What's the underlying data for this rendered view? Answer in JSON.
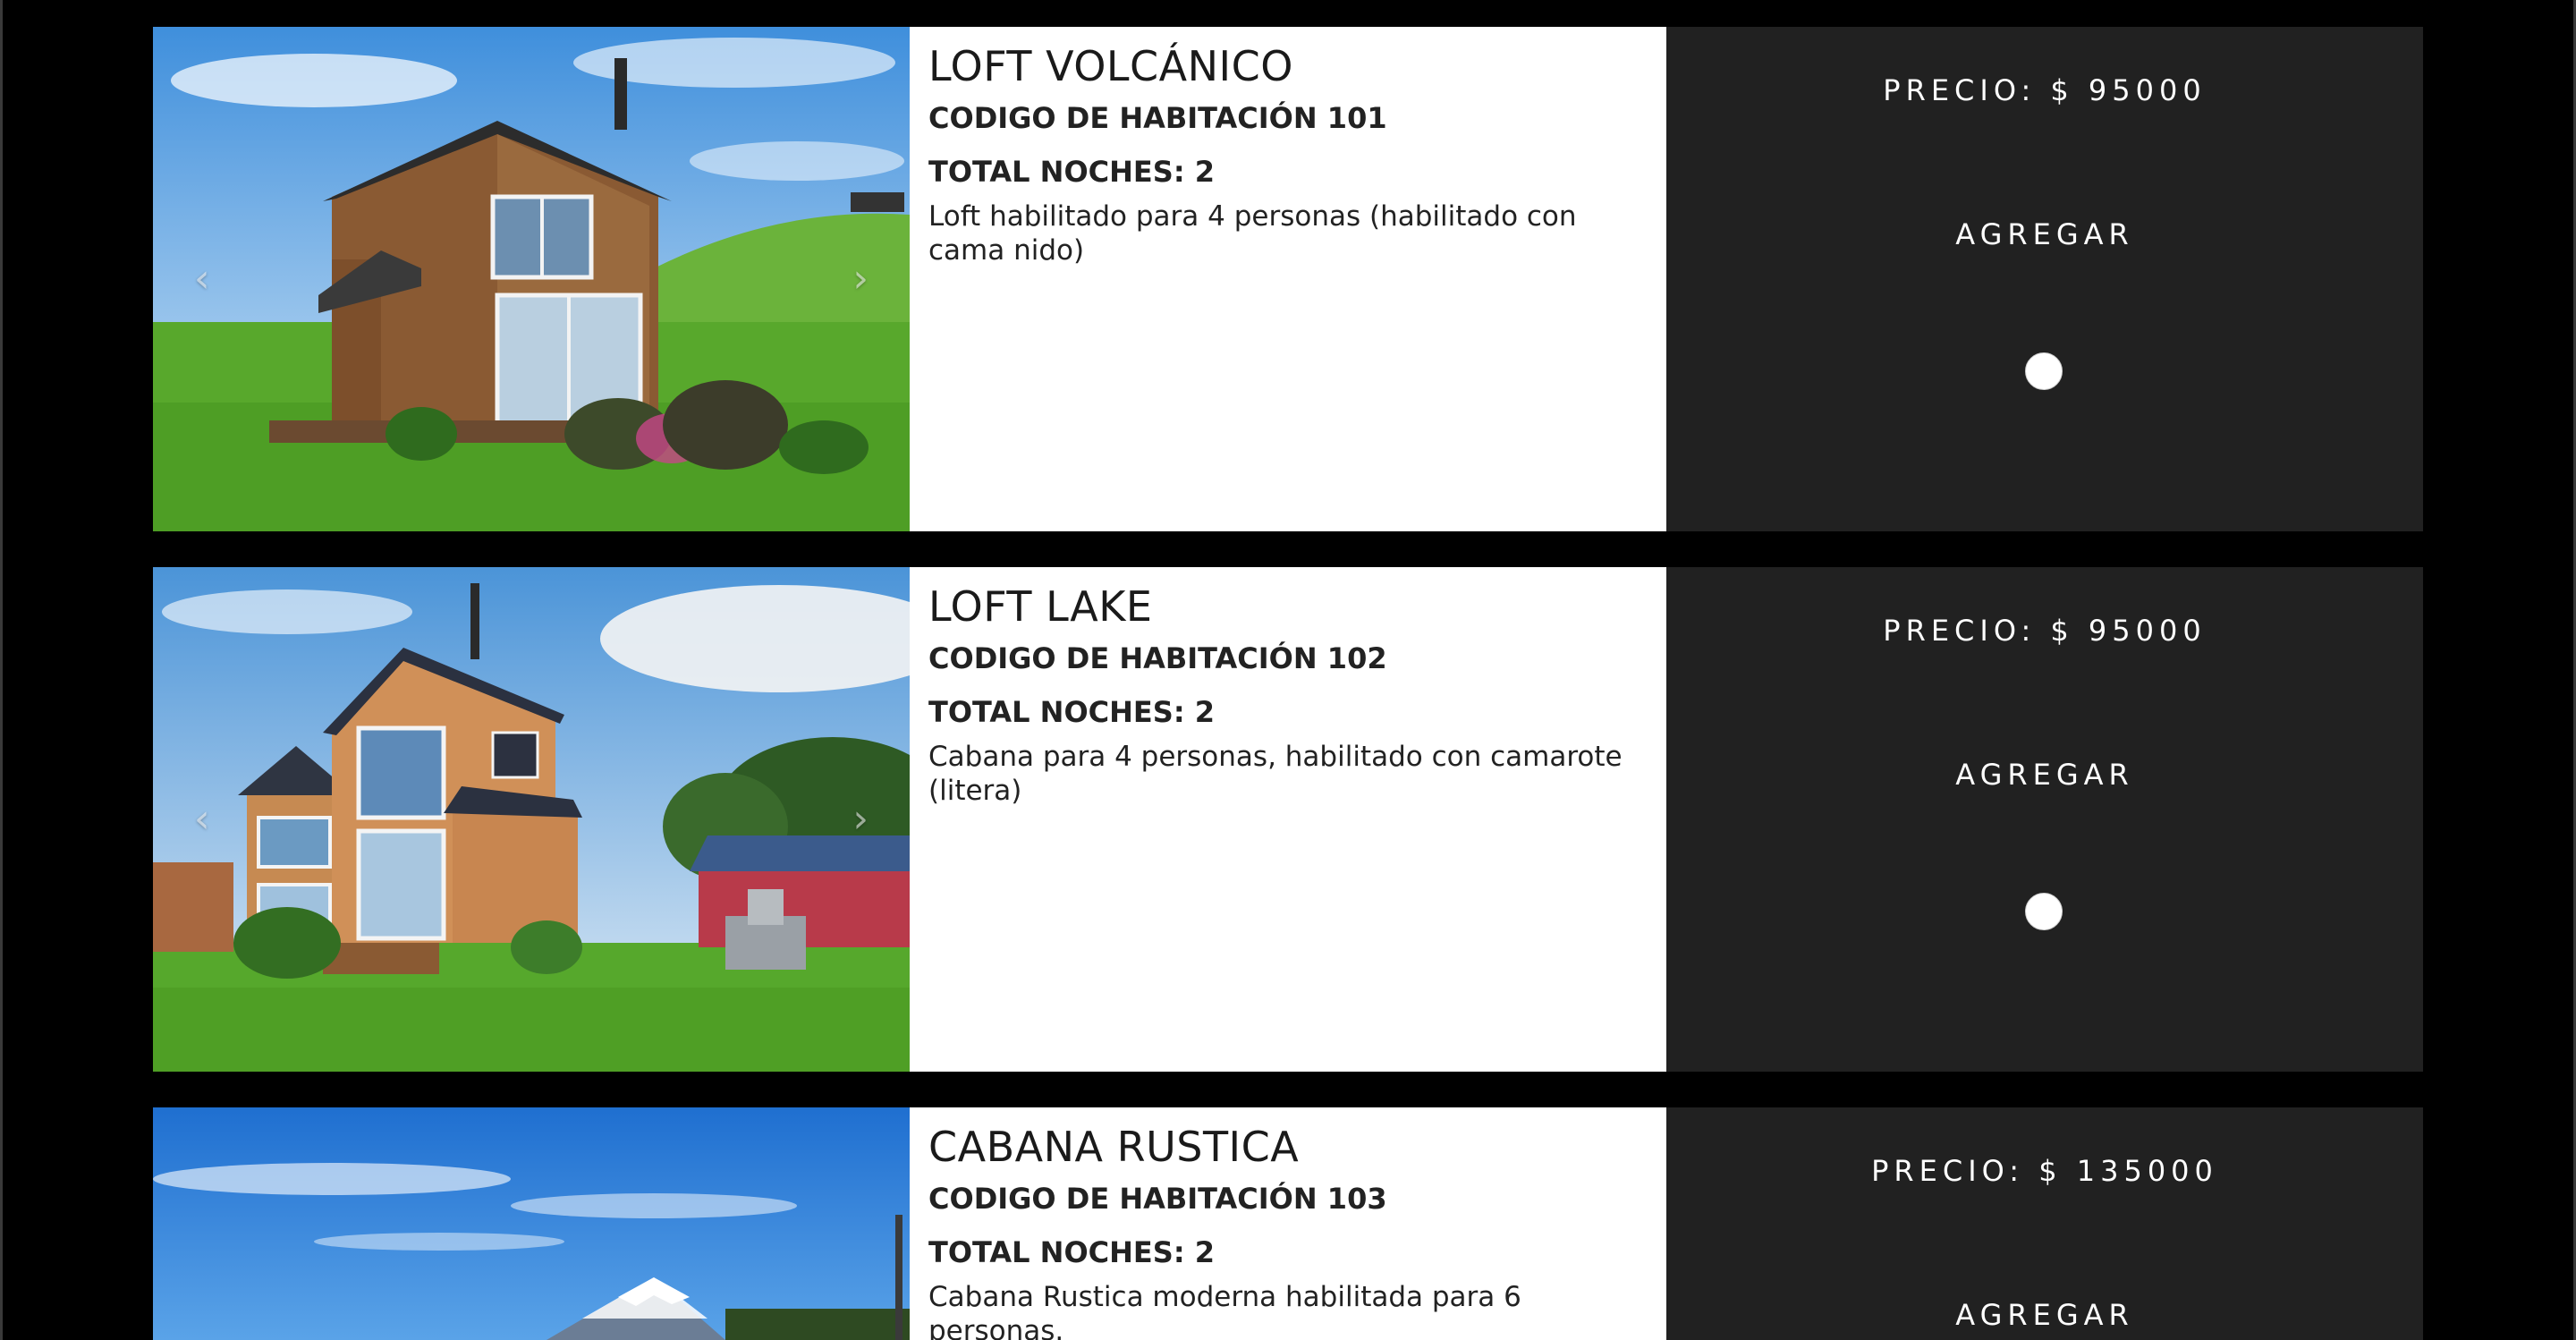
{
  "rooms": [
    {
      "title": "LOFT VOLCÁNICO",
      "code": "CODIGO DE HABITACIÓN 101",
      "nights": "TOTAL NOCHES: 2",
      "description": "Loft habilitado para 4 personas (habilitado con cama nido)",
      "price": "PRECIO: $ 95000",
      "add_label": "AGREGAR",
      "prev_icon": "chevron-left-icon",
      "next_icon": "chevron-right-icon"
    },
    {
      "title": "LOFT LAKE",
      "code": "CODIGO DE HABITACIÓN 102",
      "nights": "TOTAL NOCHES: 2",
      "description": "Cabana para 4 personas, habilitado con camarote (litera)",
      "price": "PRECIO: $ 95000",
      "add_label": "AGREGAR",
      "prev_icon": "chevron-left-icon",
      "next_icon": "chevron-right-icon"
    },
    {
      "title": "CABANA RUSTICA",
      "code": "CODIGO DE HABITACIÓN 103",
      "nights": "TOTAL NOCHES: 2",
      "description": "Cabana Rustica moderna habilitada para 6 personas.",
      "price": "PRECIO: $ 135000",
      "add_label": "AGREGAR"
    }
  ],
  "colors": {
    "background": "#000000",
    "info_panel": "#ffffff",
    "action_panel": "#212121",
    "text_dark": "#222222",
    "text_light": "#ffffff"
  }
}
